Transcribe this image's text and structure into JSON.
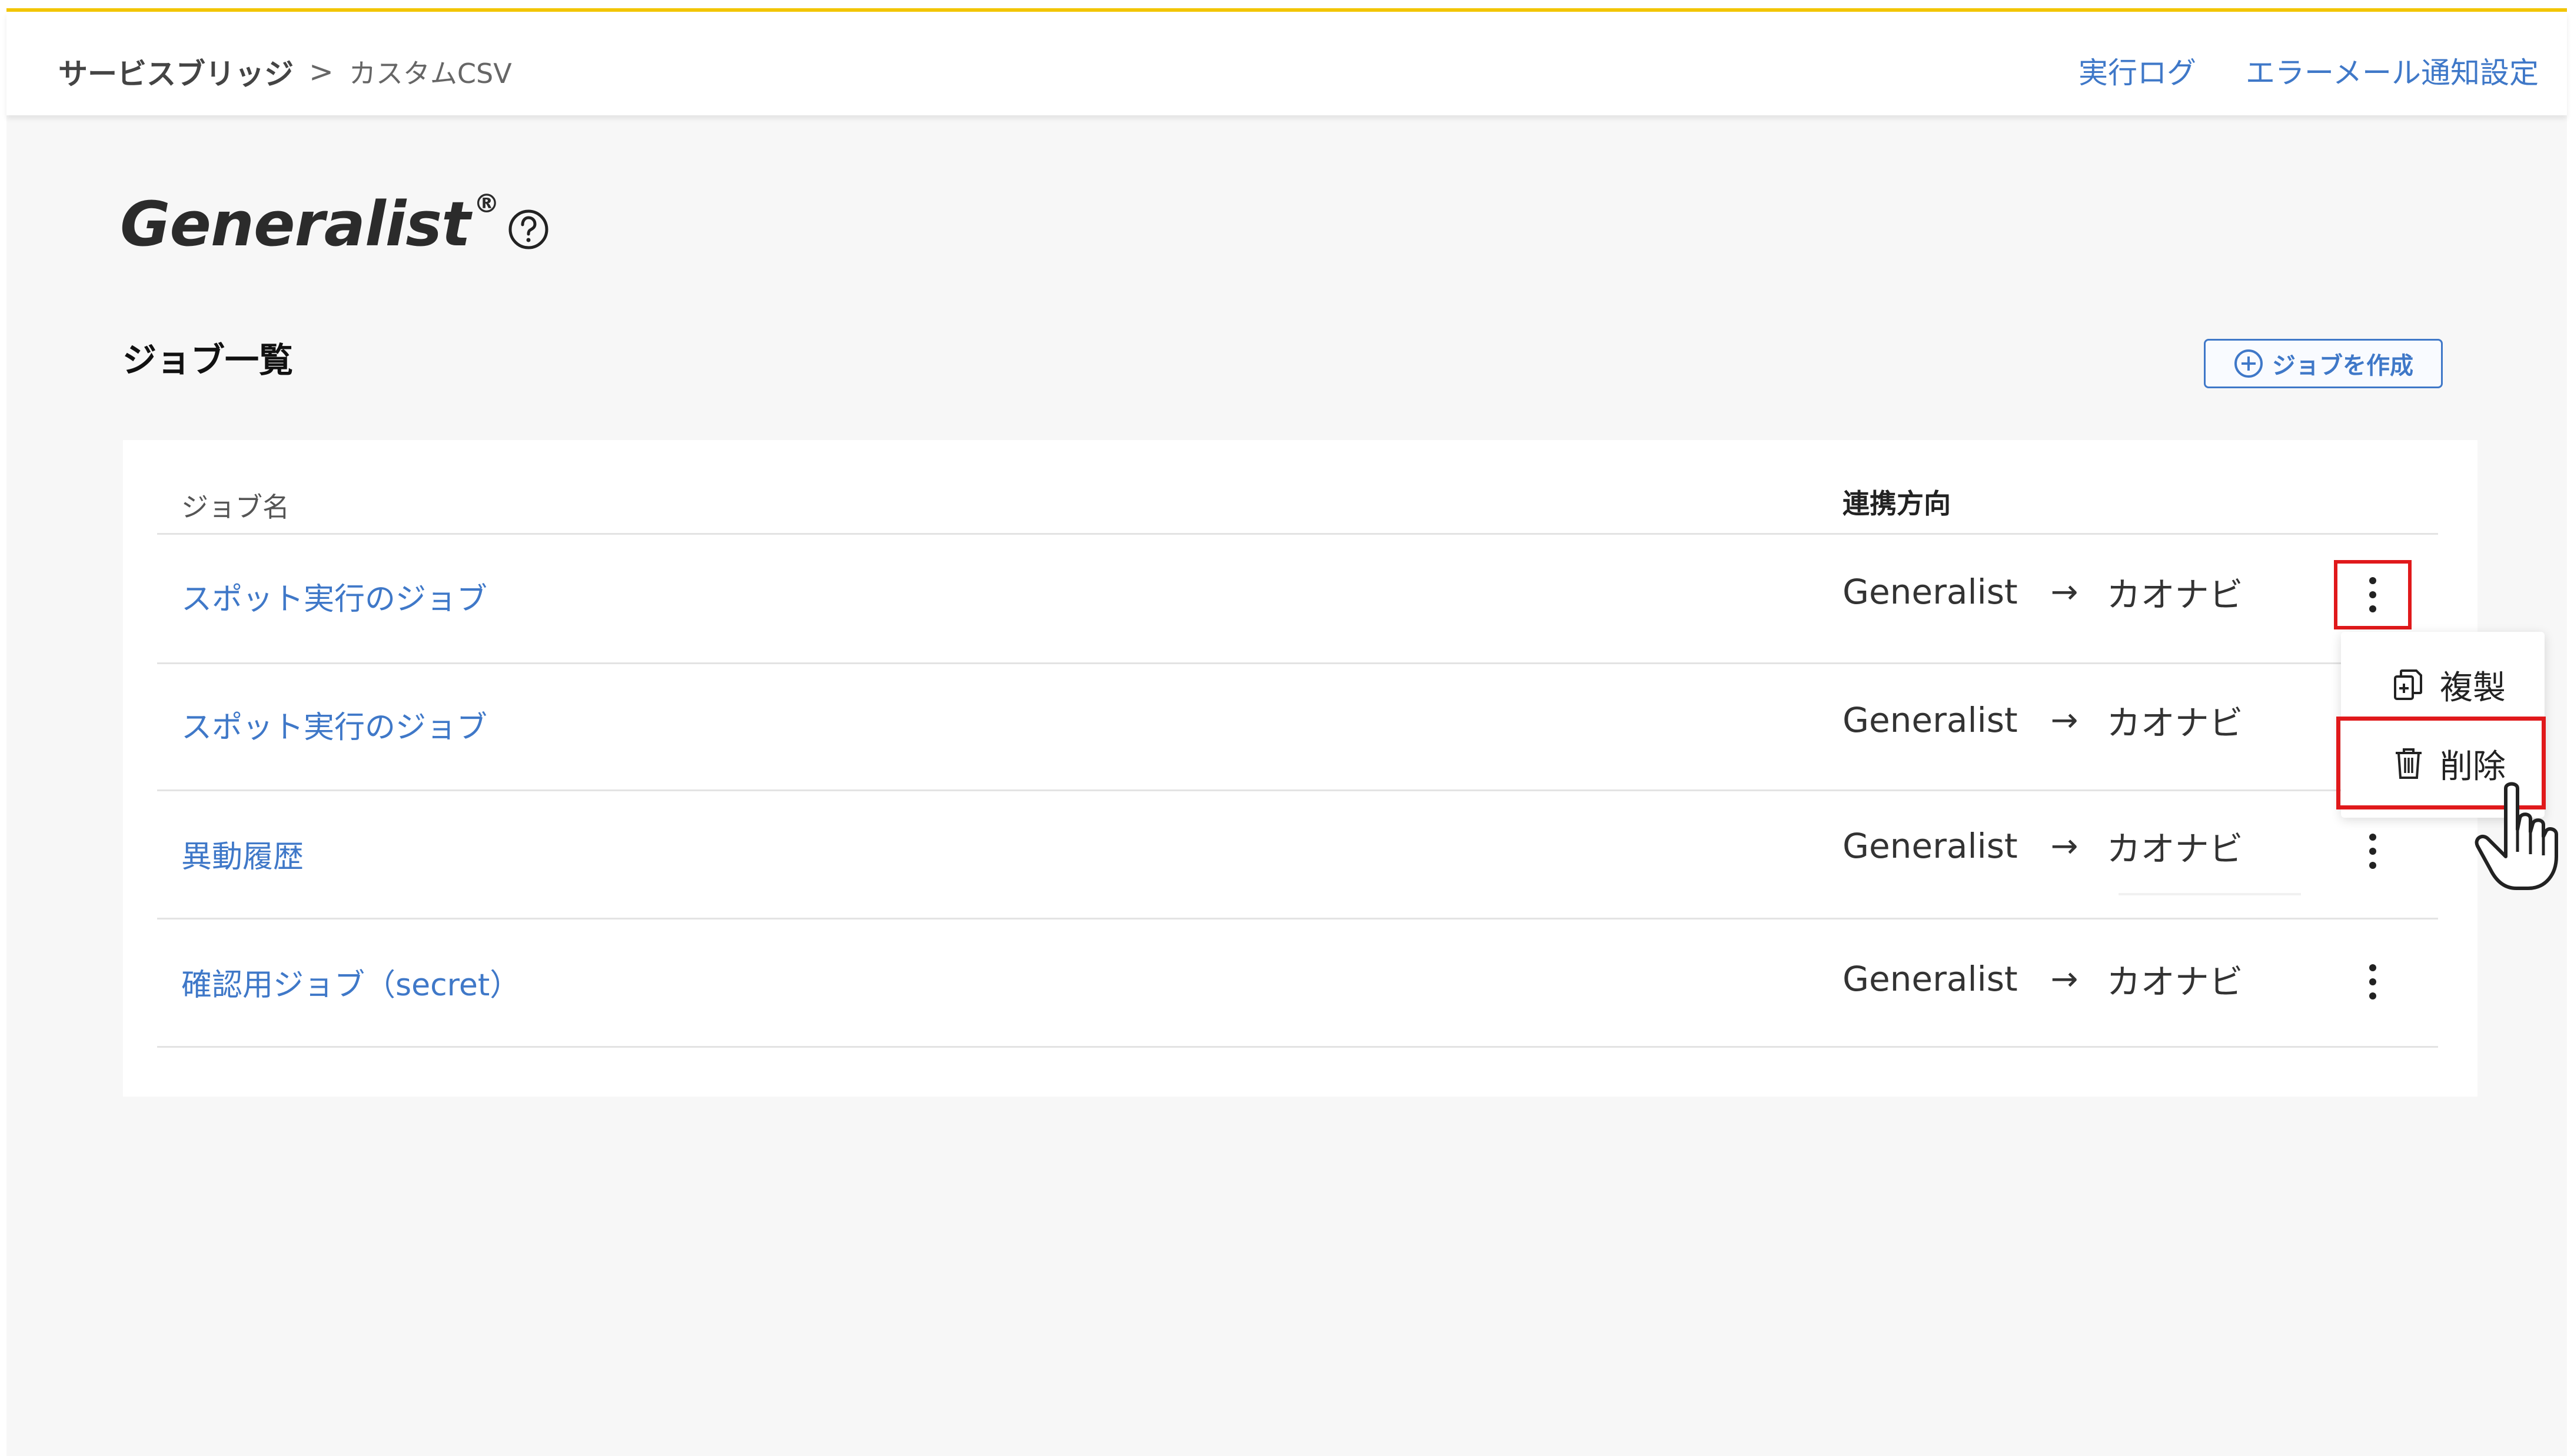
{
  "breadcrumb": {
    "root": "サービスブリッジ",
    "separator": ">",
    "current": "カスタムCSV"
  },
  "header_links": {
    "execution_log": "実行ログ",
    "error_mail_settings": "エラーメール通知設定"
  },
  "brand": {
    "name": "Generalist",
    "registered": "®"
  },
  "section": {
    "title": "ジョブ一覧",
    "create_button": "ジョブを作成"
  },
  "table": {
    "columns": {
      "job_name": "ジョブ名",
      "direction": "連携方向"
    },
    "rows": [
      {
        "name": "スポット実行のジョブ",
        "from": "Generalist",
        "arrow": "→",
        "to": "カオナビ"
      },
      {
        "name": "スポット実行のジョブ",
        "from": "Generalist",
        "arrow": "→",
        "to": "カオナビ"
      },
      {
        "name": "異動履歴",
        "from": "Generalist",
        "arrow": "→",
        "to": "カオナビ"
      },
      {
        "name": "確認用ジョブ（secret）",
        "from": "Generalist",
        "arrow": "→",
        "to": "カオナビ"
      }
    ]
  },
  "context_menu": {
    "duplicate": "複製",
    "delete": "削除"
  },
  "colors": {
    "accent": "#3f78c8",
    "highlight": "#e0191b",
    "top_border": "#f2c500"
  }
}
